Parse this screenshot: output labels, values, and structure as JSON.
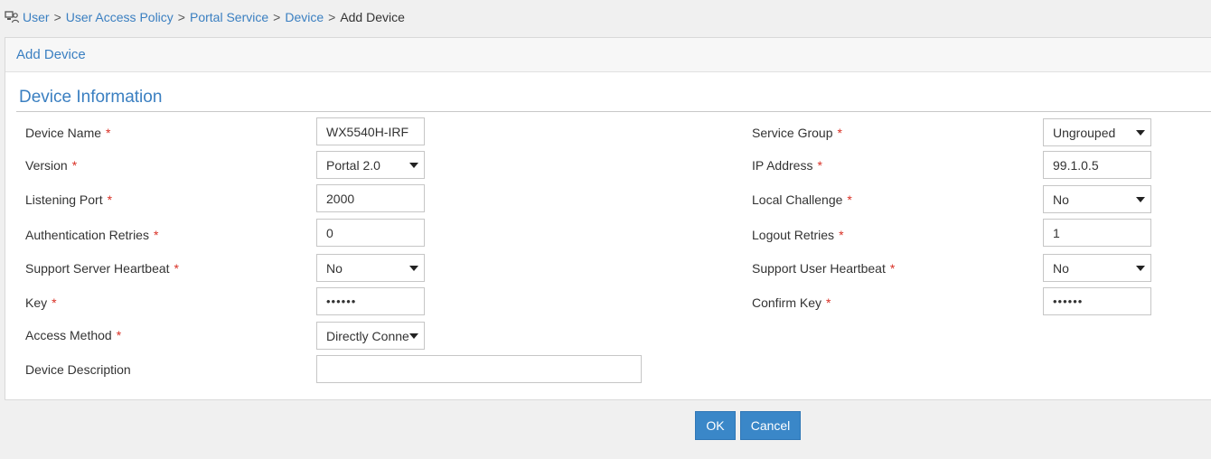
{
  "breadcrumb": {
    "items": [
      "User",
      "User Access Policy",
      "Portal Service",
      "Device"
    ],
    "separator": ">",
    "current": "Add Device"
  },
  "panel": {
    "title": "Add Device"
  },
  "section": {
    "title": "Device Information"
  },
  "required_mark": "*",
  "form": {
    "left": [
      {
        "label": "Device Name",
        "value": "WX5540H-IRF",
        "type": "text"
      },
      {
        "label": "Version",
        "value": "Portal 2.0",
        "type": "select"
      },
      {
        "label": "Listening Port",
        "value": "2000",
        "type": "text"
      },
      {
        "label": "Authentication Retries",
        "value": "0",
        "type": "text"
      },
      {
        "label": "Support Server Heartbeat",
        "value": "No",
        "type": "select"
      },
      {
        "label": "Key",
        "value": "••••••",
        "type": "password"
      },
      {
        "label": "Access Method",
        "value": "Directly Conne",
        "type": "select"
      },
      {
        "label": "Device Description",
        "value": "",
        "type": "text"
      }
    ],
    "right": [
      {
        "label": "Service Group",
        "value": "Ungrouped",
        "type": "select"
      },
      {
        "label": "IP Address",
        "value": "99.1.0.5",
        "type": "text"
      },
      {
        "label": "Local Challenge",
        "value": "No",
        "type": "select"
      },
      {
        "label": "Logout Retries",
        "value": "1",
        "type": "text"
      },
      {
        "label": "Support User Heartbeat",
        "value": "No",
        "type": "select"
      },
      {
        "label": "Confirm Key",
        "value": "••••••",
        "type": "password"
      }
    ]
  },
  "buttons": {
    "ok": "OK",
    "cancel": "Cancel"
  },
  "colors": {
    "accent": "#3a7fc1",
    "required": "#d93025",
    "button": "#3a87c8"
  }
}
